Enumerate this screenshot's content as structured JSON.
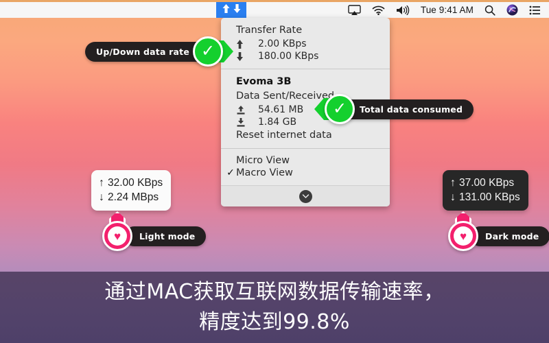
{
  "menubar": {
    "netspeed_icon_up": "↑",
    "netspeed_icon_down": "↓",
    "clock": "Tue 9:41 AM",
    "icons": [
      "airplay-icon",
      "wifi-icon",
      "volume-icon",
      "search-icon",
      "siri-icon",
      "control-center-icon"
    ]
  },
  "panel": {
    "transfer_rate": {
      "title": "Transfer Rate",
      "upload_icon": "↑",
      "upload_value": "2.00 KBps",
      "download_icon": "↓",
      "download_value": "180.00 KBps"
    },
    "network": {
      "name": "Evoma 3B",
      "subtitle": "Data Sent/Received",
      "sent_value": "54.61 MB",
      "received_value": "1.84 GB",
      "reset_label": "Reset internet data"
    },
    "views": {
      "micro": "Micro View",
      "macro": "Macro View",
      "checkmark": "✓"
    },
    "footer_icon": "chevron-down-icon"
  },
  "callouts": {
    "up_down": "Up/Down data rate",
    "total_data": "Total data consumed",
    "light_mode": "Light mode",
    "dark_mode": "Dark mode",
    "check_glyph": "✓",
    "heart_glyph": "♥"
  },
  "widgets": {
    "light": {
      "up_arrow": "↑",
      "up_value": "32.00 KBps",
      "down_arrow": "↓",
      "down_value": "2.24 MBps"
    },
    "dark": {
      "up_arrow": "↑",
      "up_value": "37.00 KBps",
      "down_arrow": "↓",
      "down_value": "131.00 KBps"
    }
  },
  "caption": {
    "line1": "通过MAC获取互联网数据传输速率，",
    "line2": "精度达到99.8%"
  },
  "colors": {
    "accent_blue": "#2a7ff0",
    "green": "#14d02e",
    "pink": "#f3206d",
    "pill_dark": "#231f20",
    "caption_band": "#53436a"
  }
}
